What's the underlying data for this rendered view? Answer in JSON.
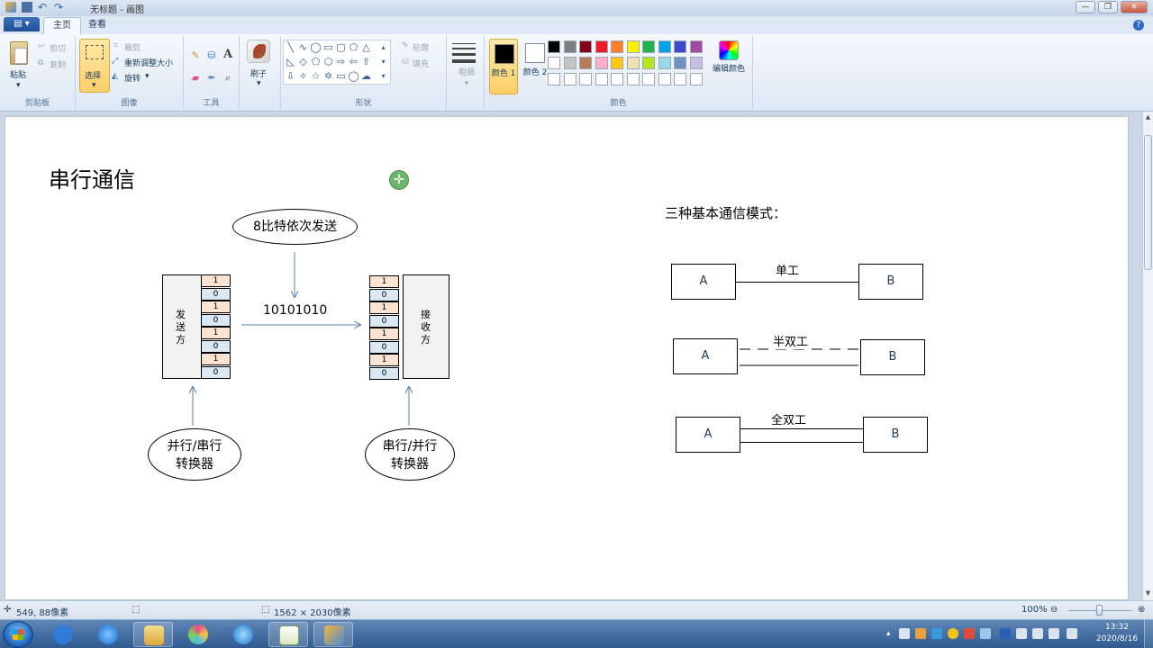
{
  "window": {
    "title": "无标题 - 画图",
    "minimize": "—",
    "restore": "❐",
    "close": "✕"
  },
  "ribbon_tabs": {
    "file": "▤ ▾",
    "home": "主页",
    "view": "查看",
    "help": "?"
  },
  "clipboard": {
    "paste": "粘贴",
    "cut": "剪切",
    "copy": "复制",
    "group": "剪贴板"
  },
  "image": {
    "select": "选择",
    "crop": "裁剪",
    "resize": "重新调整大小",
    "rotate": "旋转",
    "group": "图像"
  },
  "tools": {
    "group": "工具",
    "text_tool": "A"
  },
  "brushes": {
    "label": "刷子"
  },
  "shapes": {
    "outline": "轮廓",
    "fill": "填充",
    "group": "形状"
  },
  "size": {
    "label": "粗细"
  },
  "colors": {
    "color1": "颜色 1",
    "color2": "颜色 2",
    "color1_value": "#000000",
    "color2_value": "#ffffff",
    "edit": "编辑颜色",
    "group": "颜色",
    "palette_row1": [
      "#000000",
      "#7f7f7f",
      "#880015",
      "#ed1c24",
      "#ff7f27",
      "#fff200",
      "#22b14c",
      "#00a2e8",
      "#3f48cc",
      "#a349a4"
    ],
    "palette_row2": [
      "#ffffff",
      "#c3c3c3",
      "#b97a57",
      "#ffaec9",
      "#ffc90e",
      "#efe4b0",
      "#b5e61d",
      "#99d9ea",
      "#7092be",
      "#c8bfe7"
    ]
  },
  "drawing": {
    "title": "串行通信",
    "top_bubble": "8比特依次发送",
    "bit_string": "10101010",
    "sender": "发\n送\n方",
    "receiver": "接\n收\n方",
    "bits": [
      "1",
      "0",
      "1",
      "0",
      "1",
      "0",
      "1",
      "0"
    ],
    "left_converter": "并行/串行\n转换器",
    "right_converter": "串行/并行\n转换器",
    "modes_title": "三种基本通信模式：",
    "modes": [
      {
        "name": "单工",
        "a": "A",
        "b": "B"
      },
      {
        "name": "半双工",
        "a": "A",
        "b": "B"
      },
      {
        "name": "全双工",
        "a": "A",
        "b": "B"
      }
    ]
  },
  "status": {
    "cursor_pos": "549, 88像素",
    "canvas_size": "1562 × 2030像素",
    "zoom": "100%"
  },
  "taskbar": {
    "time": "13:32",
    "date": "2020/8/16"
  }
}
